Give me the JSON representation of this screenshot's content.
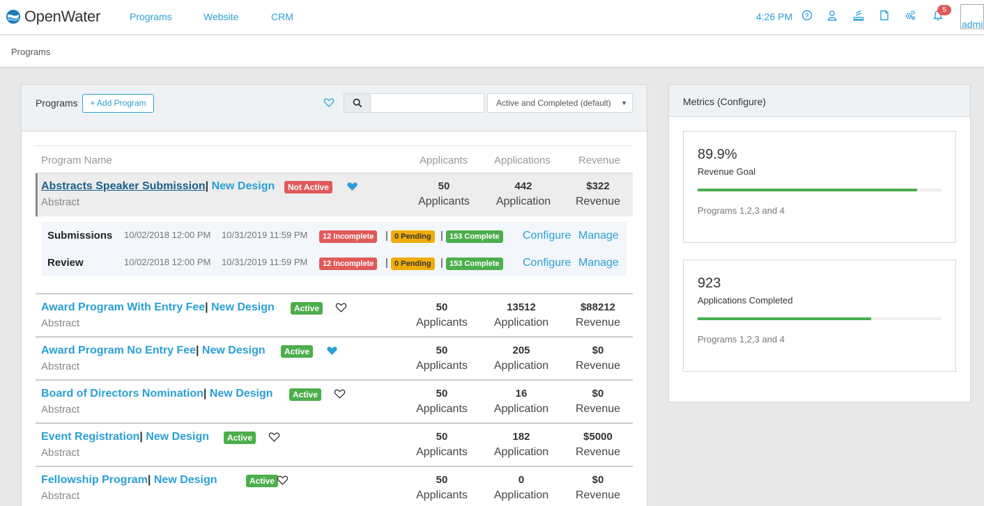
{
  "header": {
    "brand": "OpenWater",
    "nav": [
      "Programs",
      "Website",
      "CRM"
    ],
    "time": "4:26 PM",
    "notification_count": "5",
    "avatar_alt": "admi",
    "icons": [
      "help-icon",
      "user-icon",
      "stack-icon",
      "document-icon",
      "cogs-icon",
      "bell-icon"
    ]
  },
  "breadcrumb": "Programs",
  "programs_panel": {
    "title": "Programs",
    "add_label": "+ Add Program",
    "search_placeholder": "",
    "filter_value": "Active and Completed (default)",
    "columns": [
      "Program Name",
      "Applicants",
      "Applications",
      "Revenue"
    ],
    "rows": [
      {
        "name": "Abstracts Speaker Submission",
        "design": "New Design",
        "type": "Abstract",
        "status": "Not Active",
        "favorite": true,
        "applicants": "50",
        "applicants_label": "Applicants",
        "applications": "442",
        "applications_label": "Application",
        "revenue": "$322",
        "revenue_label": "Revenue"
      },
      {
        "name": "Award Program With Entry Fee",
        "design": "New Design",
        "type": "Abstract",
        "status": "Active",
        "favorite": false,
        "applicants": "50",
        "applicants_label": "Applicants",
        "applications": "13512",
        "applications_label": "Application",
        "revenue": "$88212",
        "revenue_label": "Revenue"
      },
      {
        "name": "Award Program No Entry Fee",
        "design": "New Design",
        "type": "Abstract",
        "status": "Active",
        "favorite": true,
        "applicants": "50",
        "applicants_label": "Applicants",
        "applications": "205",
        "applications_label": "Application",
        "revenue": "$0",
        "revenue_label": "Revenue"
      },
      {
        "name": "Board of Directors Nomination",
        "design": "New Design",
        "type": "Abstract",
        "status": "Active",
        "favorite": false,
        "applicants": "50",
        "applicants_label": "Applicants",
        "applications": "16",
        "applications_label": "Application",
        "revenue": "$0",
        "revenue_label": "Revenue"
      },
      {
        "name": "Event Registration",
        "design": "New Design",
        "type": "Abstract",
        "status": "Active",
        "favorite": false,
        "applicants": "50",
        "applicants_label": "Applicants",
        "applications": "182",
        "applications_label": "Application",
        "revenue": "$5000",
        "revenue_label": "Revenue"
      },
      {
        "name": "Fellowship Program",
        "design": "New Design",
        "type": "Abstract",
        "status": "Active",
        "favorite": false,
        "applicants": "50",
        "applicants_label": "Applicants",
        "applications": "0",
        "applications_label": "Application",
        "revenue": "$0",
        "revenue_label": "Revenue"
      }
    ],
    "rounds": [
      {
        "name": "Submissions",
        "start": "10/02/2018 12:00 PM",
        "end": "10/31/2019 11:59 PM",
        "incomplete": "12 Incomplete",
        "pending": "0 Pending",
        "complete": "153 Complete",
        "configure": "Configure",
        "manage": "Manage"
      },
      {
        "name": "Review",
        "start": "10/02/2018 12:00 PM",
        "end": "10/31/2019 11:59 PM",
        "incomplete": "12 Incomplete",
        "pending": "0 Pending",
        "complete": "153 Complete",
        "configure": "Configure",
        "manage": "Manage"
      }
    ]
  },
  "metrics_panel": {
    "title": "Metrics (Configure)",
    "cards": [
      {
        "value": "89.9%",
        "label": "Revenue Goal",
        "progress": 0.9,
        "footer": "Programs 1,2,3 and 4"
      },
      {
        "value": "923",
        "label": "Applications Completed",
        "progress": 0.71,
        "footer": "Programs 1,2,3 and 4"
      }
    ]
  },
  "colors": {
    "accent": "#2a9fd6",
    "active": "#4cae4c",
    "inactive": "#e05a5a",
    "pending": "#f0ad0a"
  }
}
